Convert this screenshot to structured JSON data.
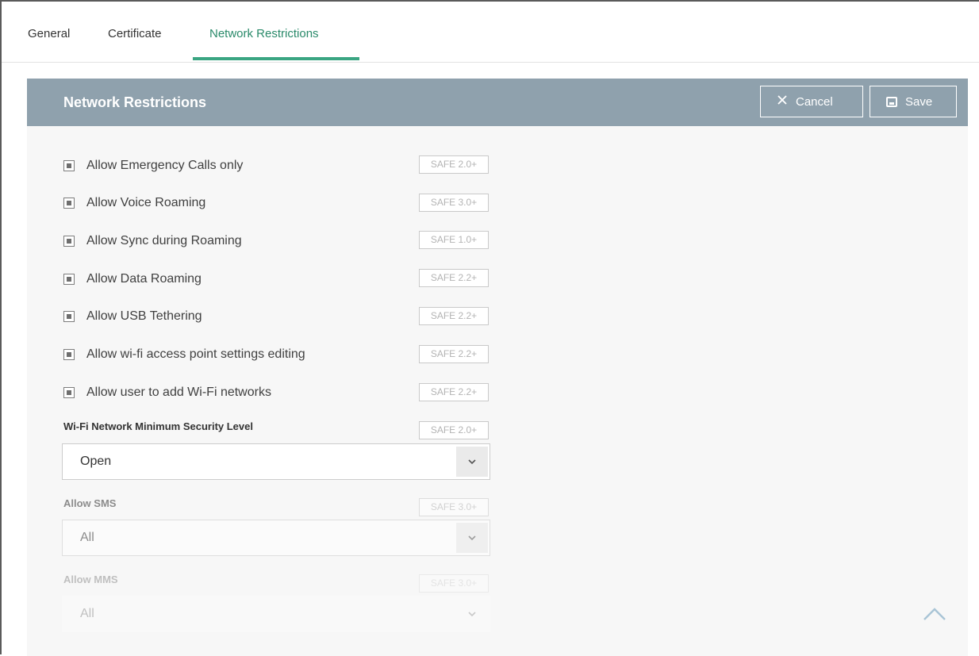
{
  "tabs": [
    {
      "label": "General"
    },
    {
      "label": "Certificate"
    },
    {
      "label": "Network Restrictions",
      "active": true
    }
  ],
  "panel": {
    "title": "Network Restrictions",
    "cancel_label": "Cancel",
    "save_label": "Save"
  },
  "options": [
    {
      "label": "Allow Emergency Calls only",
      "badge": "SAFE 2.0+",
      "checked": true
    },
    {
      "label": "Allow Voice Roaming",
      "badge": "SAFE 3.0+",
      "checked": true
    },
    {
      "label": "Allow Sync during Roaming",
      "badge": "SAFE 1.0+",
      "checked": true
    },
    {
      "label": "Allow Data Roaming",
      "badge": "SAFE 2.2+",
      "checked": true
    },
    {
      "label": "Allow USB Tethering",
      "badge": "SAFE 2.2+",
      "checked": true
    },
    {
      "label": "Allow wi-fi access point settings editing",
      "badge": "SAFE 2.2+",
      "checked": true
    },
    {
      "label": "Allow user to add Wi-Fi networks",
      "badge": "SAFE 2.2+",
      "checked": true
    }
  ],
  "wifi_security": {
    "label": "Wi-Fi Network Minimum Security Level",
    "badge": "SAFE 2.0+",
    "value": "Open"
  },
  "allow_sms": {
    "label": "Allow SMS",
    "badge": "SAFE 3.0+",
    "value": "All"
  },
  "allow_mms": {
    "label": "Allow MMS",
    "badge": "SAFE 3.0+",
    "value": "All"
  },
  "colors": {
    "accent": "#3aa582",
    "header_bg": "#8fa1ad",
    "content_bg": "#f7f7f7"
  },
  "icons": {
    "cancel": "close-icon",
    "save": "floppy-disk-icon",
    "dropdown": "chevron-down-icon",
    "scroll_top": "chevron-up-icon"
  }
}
